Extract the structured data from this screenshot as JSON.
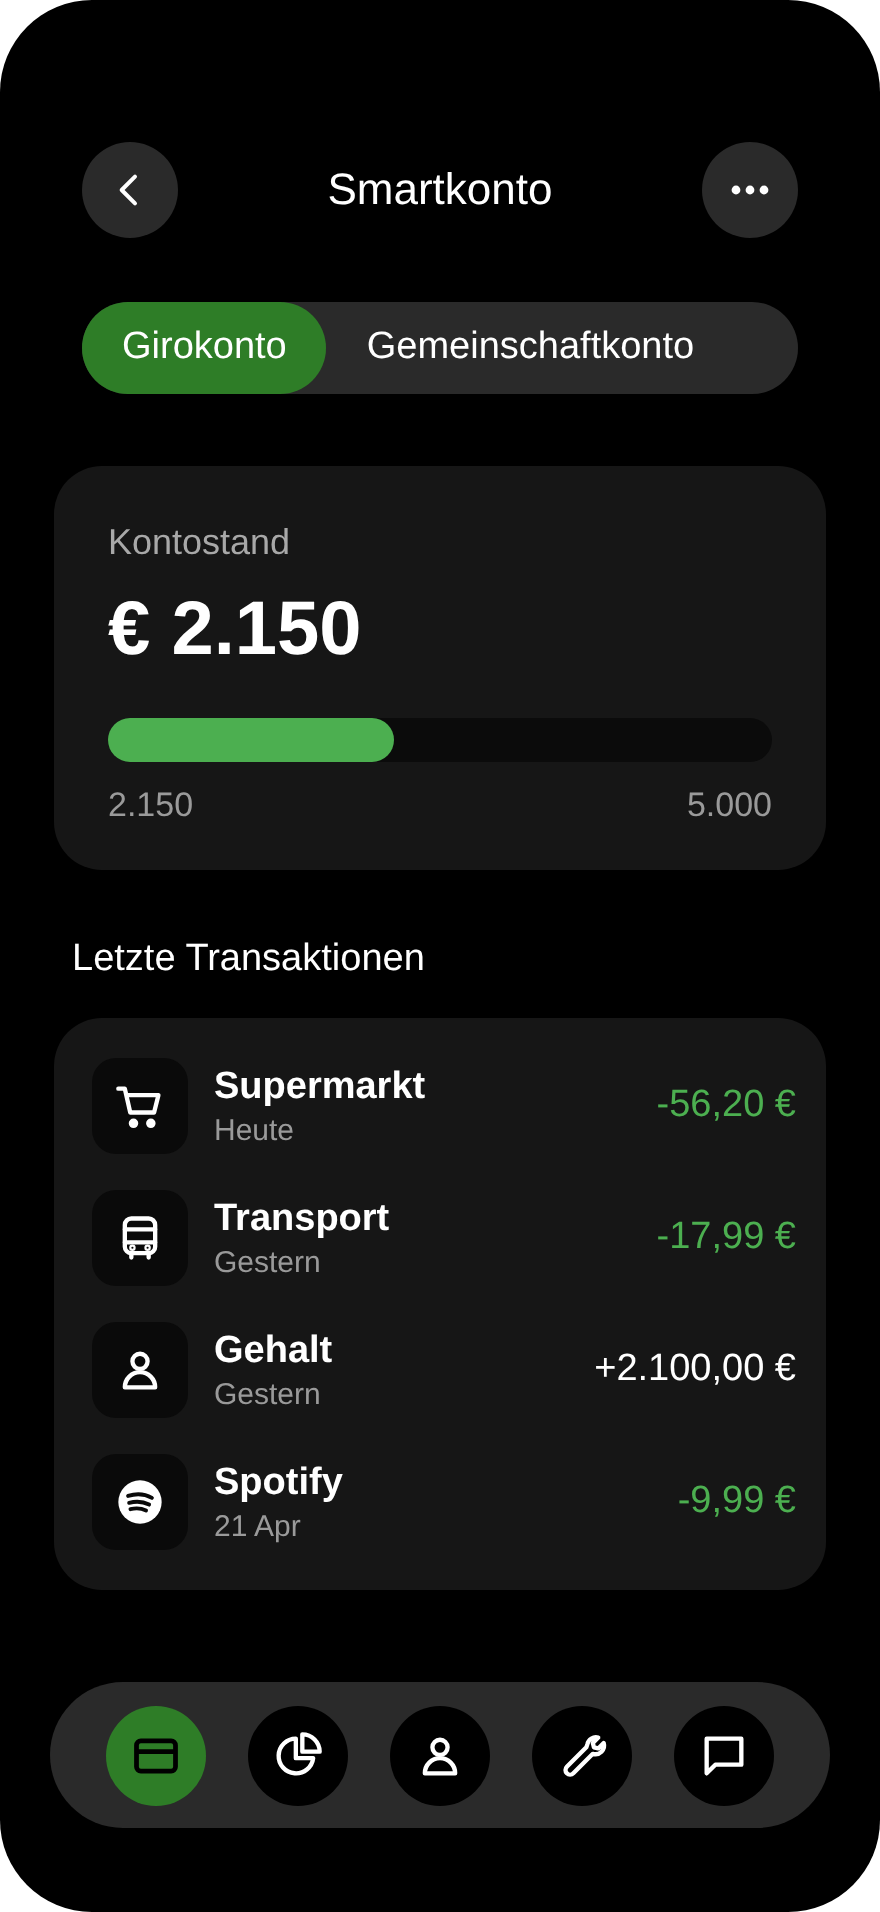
{
  "header": {
    "title": "Smartkonto"
  },
  "tabs": [
    {
      "label": "Girokonto",
      "selected": true
    },
    {
      "label": "Gemeinschaftkonto",
      "selected": false
    }
  ],
  "balance": {
    "label": "Kontostand",
    "amount": "€ 2.150",
    "level": 0.43,
    "min_label": "2.150",
    "max_label": "5.000"
  },
  "transactions_title": "Letzte Transaktionen",
  "transactions": [
    {
      "name": "Supermarkt",
      "date": "Heute",
      "amount": "-56,20 €",
      "kind": "debit"
    },
    {
      "name": "Transport",
      "date": "Gestern",
      "amount": "-17,99 €",
      "kind": "debit"
    },
    {
      "name": "Gehalt",
      "date": "Gestern",
      "amount": "+2.100,00 €",
      "kind": "credit"
    },
    {
      "name": "Spotify",
      "date": "21 Apr",
      "amount": "-9,99 €",
      "kind": "debit"
    }
  ],
  "nav": [
    {
      "selected": true
    },
    {
      "selected": false
    },
    {
      "selected": false
    },
    {
      "selected": false
    },
    {
      "selected": false
    }
  ]
}
